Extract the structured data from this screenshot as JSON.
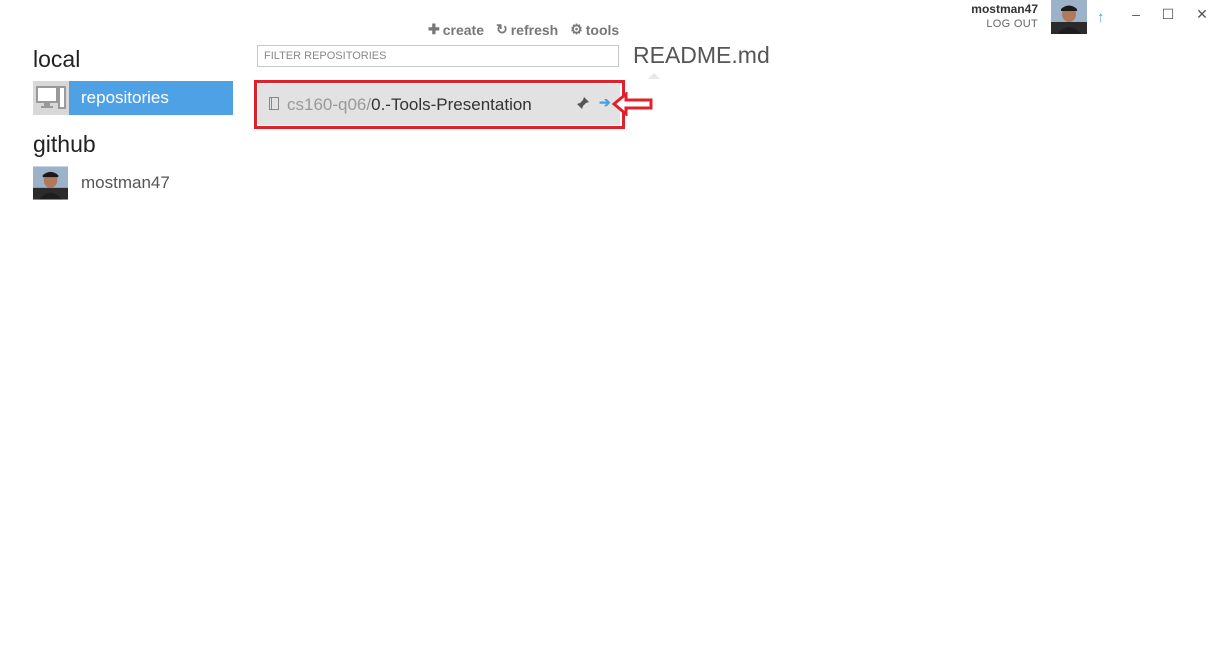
{
  "toolbar": {
    "create_label": "create",
    "refresh_label": "refresh",
    "tools_label": "tools"
  },
  "account": {
    "username": "mostman47",
    "logout_label": "LOG OUT"
  },
  "window_controls": {
    "minimize": "–",
    "maximize": "☐",
    "close": "✕"
  },
  "sidebar": {
    "local_title": "local",
    "local_items": [
      {
        "label": "repositories",
        "icon": "computer-icon",
        "selected": true
      }
    ],
    "github_title": "github",
    "github_items": [
      {
        "label": "mostman47",
        "icon": "avatar"
      }
    ]
  },
  "filter": {
    "placeholder": "FILTER REPOSITORIES",
    "value": ""
  },
  "repositories": [
    {
      "owner": "cs160-q06/",
      "name": "0.-Tools-Presentation"
    }
  ],
  "readme": {
    "title": "README.md"
  },
  "colors": {
    "accent": "#4ea1e5",
    "highlight": "#e0202a",
    "row_bg": "#e2e2e2"
  }
}
